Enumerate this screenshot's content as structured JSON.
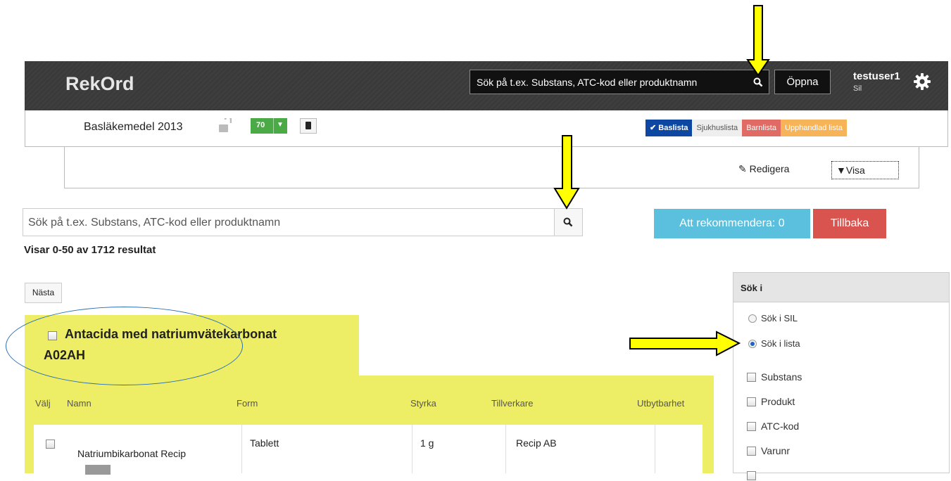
{
  "header": {
    "logo": "RekOrd",
    "search_placeholder": "Sök på t.ex. Substans, ATC-kod eller produktnamn",
    "open_label": "Öppna",
    "user_name": "testuser1",
    "user_sub": "Sil"
  },
  "listbar": {
    "title": "Basläkemedel 2013",
    "count": "70",
    "tabs": [
      "Baslista",
      "Sjukhuslista",
      "Barnlista",
      "Upphandlad lista"
    ]
  },
  "subpanel": {
    "edit_label": "Redigera",
    "view_label": "Visa"
  },
  "search": {
    "placeholder": "Sök på t.ex. Substans, ATC-kod eller produktnamn",
    "recommend_label": "Att rekommendera: 0",
    "back_label": "Tillbaka",
    "result_text": "Visar 0-50 av 1712 resultat",
    "next_label": "Nästa"
  },
  "group": {
    "title": "Antacida med natriumvätekarbonat",
    "code": "A02AH"
  },
  "table": {
    "columns": [
      "Välj",
      "Namn",
      "Form",
      "Styrka",
      "Tillverkare",
      "Utbytbarhet"
    ],
    "rows": [
      {
        "name": "Natriumbikarbonat Recip",
        "form": "Tablett",
        "strength": "1 g",
        "manufacturer": "Recip AB",
        "badge": ""
      }
    ]
  },
  "sidebar": {
    "title": "Sök i",
    "radios": [
      {
        "label": "Sök i SIL",
        "selected": false
      },
      {
        "label": "Sök i lista",
        "selected": true
      }
    ],
    "checkboxes": [
      "Substans",
      "Produkt",
      "ATC-kod",
      "Varunr",
      ""
    ]
  },
  "colors": {
    "topbar": "#3a3a3a",
    "group_highlight": "#eeee66",
    "tab_bas": "#0d47a1",
    "tab_barn": "#e06a64",
    "tab_upp": "#f7b357",
    "recommend": "#5bc0de",
    "back": "#d9534f",
    "count_badge": "#4aaa46",
    "annotation_arrow": "#ffff00",
    "annotation_ellipse": "#2a6fb4"
  },
  "icons": [
    "search-icon",
    "gear-icon",
    "lock-open-icon",
    "caret-down-icon",
    "book-icon",
    "check-icon",
    "edit-icon"
  ]
}
